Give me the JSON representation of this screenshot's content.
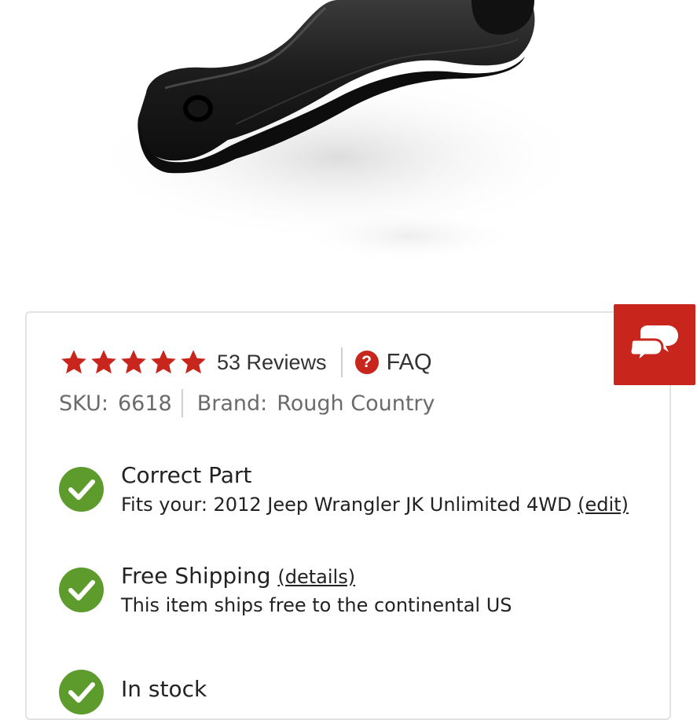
{
  "rating": {
    "stars": 5,
    "reviews_label": "53 Reviews",
    "faq_label": "FAQ"
  },
  "sku": {
    "label": "SKU:",
    "value": "6618"
  },
  "brand": {
    "label": "Brand:",
    "value": "Rough Country"
  },
  "features": [
    {
      "title": "Correct Part",
      "desc_prefix": "Fits your: 2012 Jeep Wrangler JK Unlimited 4WD",
      "link": "(edit)"
    },
    {
      "title": "Free Shipping",
      "link": "(details)",
      "desc": "This item ships free to the continental US"
    },
    {
      "title": "In stock"
    }
  ],
  "colors": {
    "accent_red": "#c8261d",
    "check_green": "#5c9b2c"
  },
  "icons": {
    "chat": "chat-bubbles-icon",
    "faq": "question-circle-icon",
    "check": "checkmark-icon"
  }
}
